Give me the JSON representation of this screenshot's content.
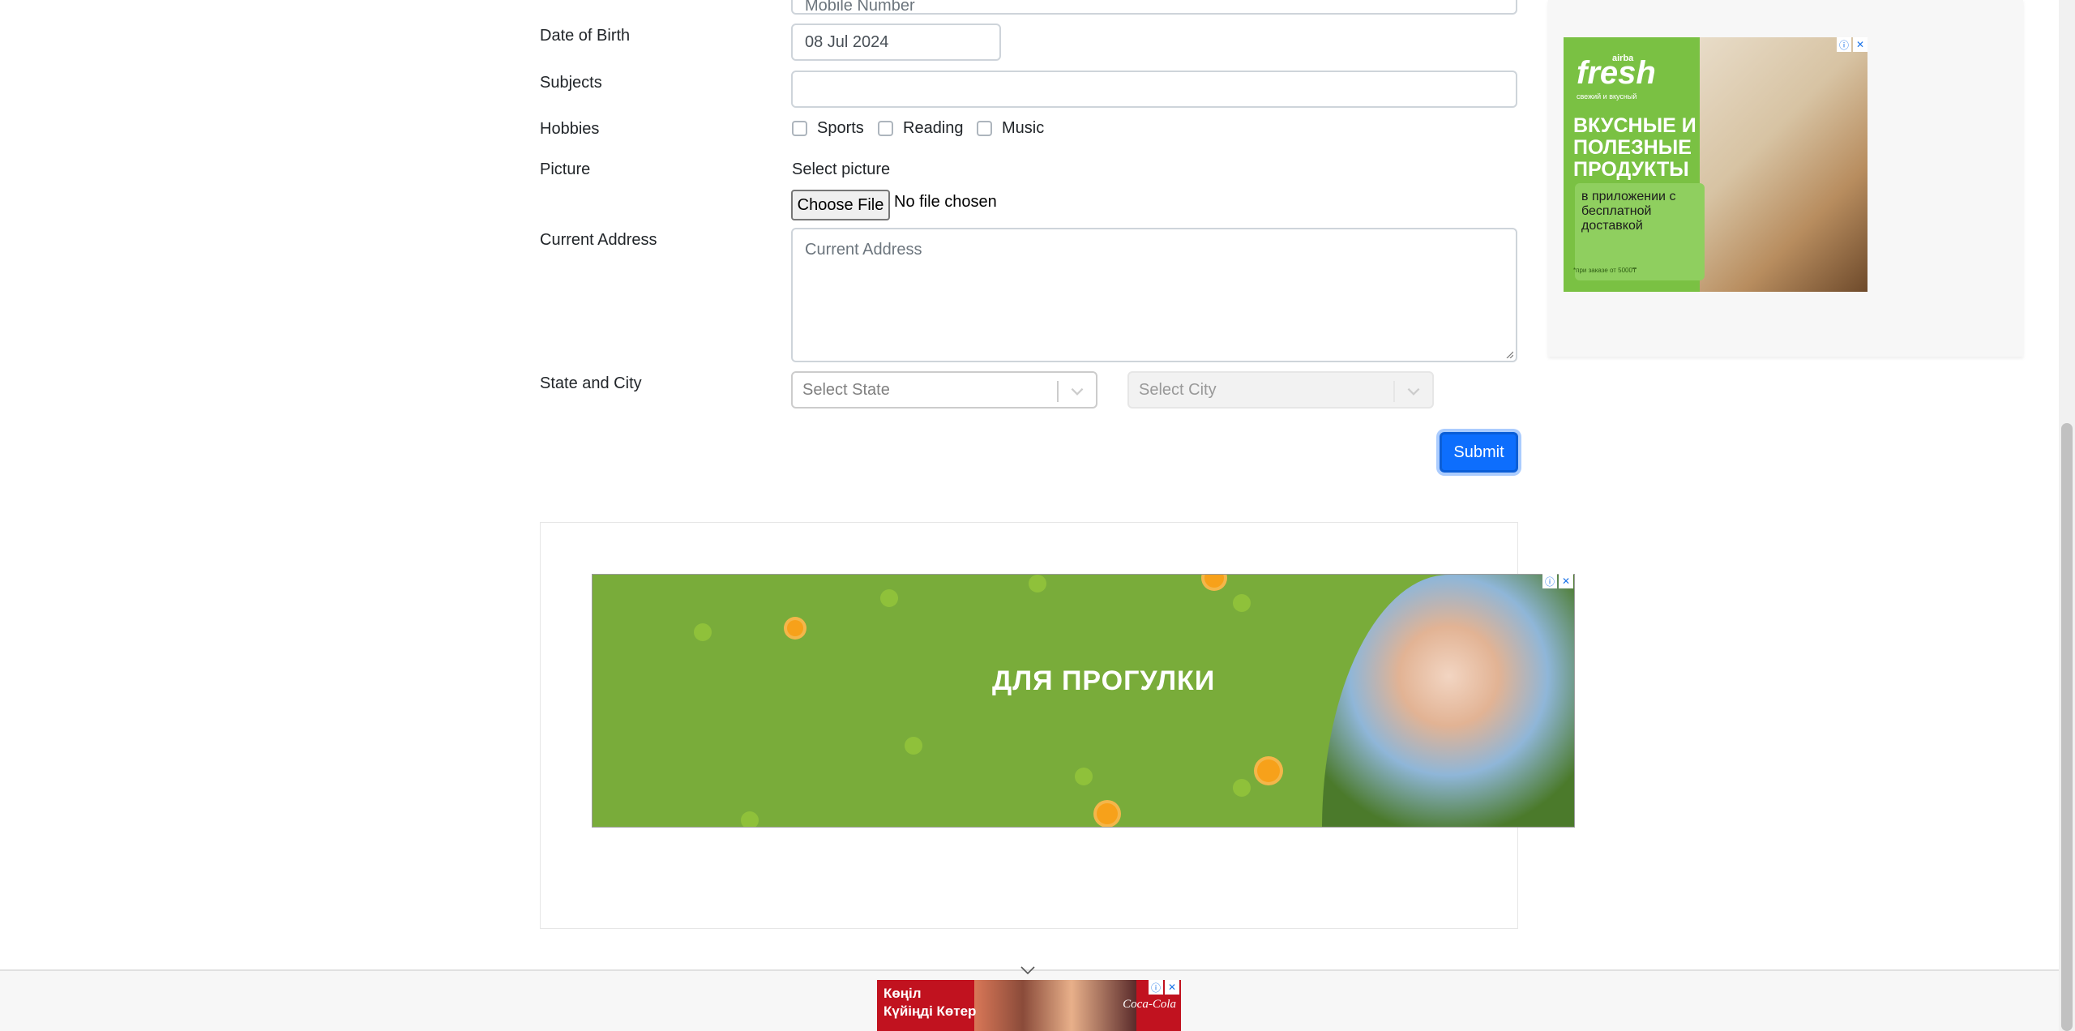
{
  "form": {
    "mobile_placeholder": "Mobile Number",
    "dob": {
      "label": "Date of Birth",
      "value": "08 Jul 2024"
    },
    "subjects": {
      "label": "Subjects",
      "value": ""
    },
    "hobbies": {
      "label": "Hobbies",
      "options": [
        {
          "label": "Sports",
          "checked": false
        },
        {
          "label": "Reading",
          "checked": false
        },
        {
          "label": "Music",
          "checked": false
        }
      ]
    },
    "picture": {
      "label": "Picture",
      "select_label": "Select picture",
      "button_label": "Choose File",
      "status": "No file chosen"
    },
    "address": {
      "label": "Current Address",
      "placeholder": "Current Address"
    },
    "state_city": {
      "label": "State and City",
      "state_placeholder": "Select State",
      "city_placeholder": "Select City"
    },
    "submit_label": "Submit"
  },
  "ads": {
    "fresh": {
      "brand_small": "airba",
      "brand": "fresh",
      "tagline": "свежий и вкусный",
      "headline": "ВКУСНЫЕ И ПОЛЕЗНЫЕ ПРОДУКТЫ",
      "sub": "в приложении с бесплатной доставкой",
      "note": "*при заказе от 5000₸"
    },
    "banner": {
      "headline": "ДЛЯ ПРОГУЛКИ"
    },
    "bottom": {
      "text_line1": "Көңіл",
      "text_line2": "Күйіңді Көтер",
      "logo": "Coca-Cola"
    },
    "controls": {
      "info": "ⓘ",
      "close": "✕"
    }
  },
  "colors": {
    "primary": "#0d6efd",
    "ad_green": "#7ac143",
    "banner_green": "#79ac3a",
    "coke_red": "#c1121f"
  }
}
